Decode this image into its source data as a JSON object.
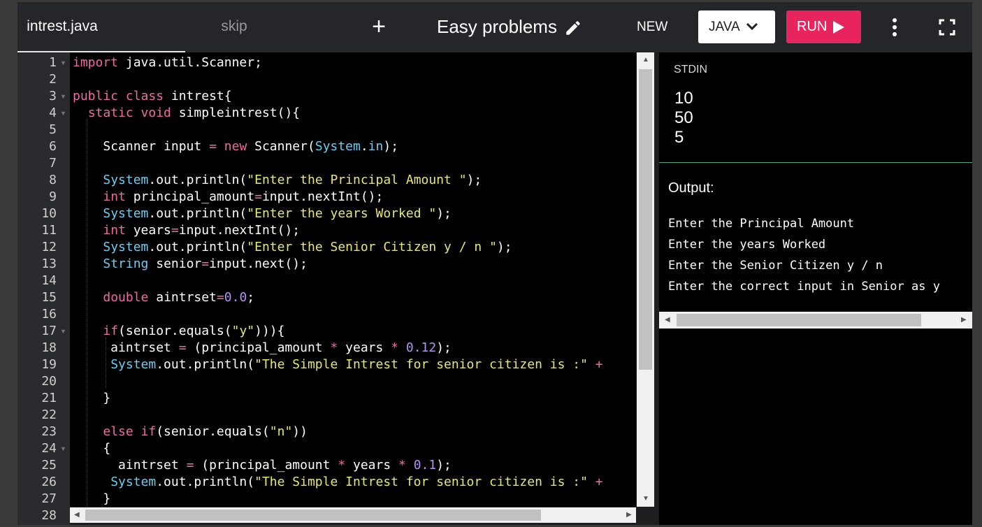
{
  "topbar": {
    "file_tab": "intrest.java",
    "skip_tab": "skip",
    "add_label": "+",
    "title": "Easy problems",
    "new_label": "NEW",
    "language": "JAVA",
    "run_label": "RUN",
    "icons": [
      "pencil-icon",
      "chevron-down-icon",
      "play-icon",
      "more-vertical-icon",
      "fullscreen-icon"
    ]
  },
  "colors": {
    "run_button": "#e8245f",
    "keyword": "#f268a8",
    "type": "#65d0f2",
    "string": "#e8e86e",
    "number": "#b490f5",
    "divider": "#3fae8f"
  },
  "editor": {
    "line_numbers": [
      "1",
      "2",
      "3",
      "4",
      "5",
      "6",
      "7",
      "8",
      "9",
      "10",
      "11",
      "12",
      "13",
      "14",
      "15",
      "16",
      "17",
      "18",
      "19",
      "20",
      "21",
      "22",
      "23",
      "24",
      "25",
      "26",
      "27",
      "28"
    ],
    "code_lines": [
      [
        [
          "kw",
          "import"
        ],
        [
          "pl",
          " java.util.Scanner;"
        ]
      ],
      [],
      [
        [
          "kw",
          "public class"
        ],
        [
          "pl",
          " intrest{"
        ]
      ],
      [
        [
          "pl",
          "  "
        ],
        [
          "kw",
          "static void"
        ],
        [
          "pl",
          " simpleintrest(){"
        ]
      ],
      [],
      [
        [
          "pl",
          "    Scanner input "
        ],
        [
          "op",
          "="
        ],
        [
          "pl",
          " "
        ],
        [
          "kw",
          "new"
        ],
        [
          "pl",
          " Scanner("
        ],
        [
          "ty",
          "System"
        ],
        [
          "pl",
          "."
        ],
        [
          "ty",
          "in"
        ],
        [
          "pl",
          ");"
        ]
      ],
      [],
      [
        [
          "pl",
          "    "
        ],
        [
          "ty",
          "System"
        ],
        [
          "pl",
          ".out.println("
        ],
        [
          "st",
          "\"Enter the Principal Amount \""
        ],
        [
          "pl",
          ");"
        ]
      ],
      [
        [
          "pl",
          "    "
        ],
        [
          "kw",
          "int"
        ],
        [
          "pl",
          " principal_amount"
        ],
        [
          "op",
          "="
        ],
        [
          "pl",
          "input.nextInt();"
        ]
      ],
      [
        [
          "pl",
          "    "
        ],
        [
          "ty",
          "System"
        ],
        [
          "pl",
          ".out.println("
        ],
        [
          "st",
          "\"Enter the years Worked \""
        ],
        [
          "pl",
          ");"
        ]
      ],
      [
        [
          "pl",
          "    "
        ],
        [
          "kw",
          "int"
        ],
        [
          "pl",
          " years"
        ],
        [
          "op",
          "="
        ],
        [
          "pl",
          "input.nextInt();"
        ]
      ],
      [
        [
          "pl",
          "    "
        ],
        [
          "ty",
          "System"
        ],
        [
          "pl",
          ".out.println("
        ],
        [
          "st",
          "\"Enter the Senior Citizen y / n \""
        ],
        [
          "pl",
          ");"
        ]
      ],
      [
        [
          "pl",
          "    "
        ],
        [
          "ty",
          "String"
        ],
        [
          "pl",
          " senior"
        ],
        [
          "op",
          "="
        ],
        [
          "pl",
          "input.next();"
        ]
      ],
      [],
      [
        [
          "pl",
          "    "
        ],
        [
          "kw",
          "double"
        ],
        [
          "pl",
          " aintrset"
        ],
        [
          "op",
          "="
        ],
        [
          "nu",
          "0.0"
        ],
        [
          "pl",
          ";"
        ]
      ],
      [],
      [
        [
          "pl",
          "    "
        ],
        [
          "kw",
          "if"
        ],
        [
          "pl",
          "(senior.equals("
        ],
        [
          "st",
          "\"y\""
        ],
        [
          "pl",
          "))){"
        ]
      ],
      [
        [
          "pl",
          "     aintrset "
        ],
        [
          "op",
          "="
        ],
        [
          "pl",
          " (principal_amount "
        ],
        [
          "op",
          "*"
        ],
        [
          "pl",
          " years "
        ],
        [
          "op",
          "*"
        ],
        [
          "pl",
          " "
        ],
        [
          "nu",
          "0.12"
        ],
        [
          "pl",
          ");"
        ]
      ],
      [
        [
          "pl",
          "     "
        ],
        [
          "ty",
          "System"
        ],
        [
          "pl",
          ".out.println("
        ],
        [
          "st",
          "\"The Simple Intrest for senior citizen is :\""
        ],
        [
          "pl",
          " "
        ],
        [
          "op",
          "+"
        ]
      ],
      [],
      [
        [
          "pl",
          "    }"
        ]
      ],
      [],
      [
        [
          "pl",
          "    "
        ],
        [
          "kw",
          "else if"
        ],
        [
          "pl",
          "(senior.equals("
        ],
        [
          "st",
          "\"n\""
        ],
        [
          "pl",
          "))"
        ]
      ],
      [
        [
          "pl",
          "    {"
        ]
      ],
      [
        [
          "pl",
          "      aintrset "
        ],
        [
          "op",
          "="
        ],
        [
          "pl",
          " (principal_amount "
        ],
        [
          "op",
          "*"
        ],
        [
          "pl",
          " years "
        ],
        [
          "op",
          "*"
        ],
        [
          "pl",
          " "
        ],
        [
          "nu",
          "0.1"
        ],
        [
          "pl",
          ");"
        ]
      ],
      [
        [
          "pl",
          "     "
        ],
        [
          "ty",
          "System"
        ],
        [
          "pl",
          ".out.println("
        ],
        [
          "st",
          "\"The Simple Intrest for senior citizen is :\""
        ],
        [
          "pl",
          " "
        ],
        [
          "op",
          "+"
        ]
      ],
      [
        [
          "pl",
          "    }"
        ]
      ],
      []
    ]
  },
  "stdin": {
    "label": "STDIN",
    "values": [
      "10",
      "50",
      "5"
    ]
  },
  "output": {
    "label": "Output:",
    "lines": [
      "Enter the Principal Amount",
      "Enter the years Worked",
      "Enter the Senior Citizen y / n",
      "Enter the correct input in Senior as y"
    ]
  }
}
